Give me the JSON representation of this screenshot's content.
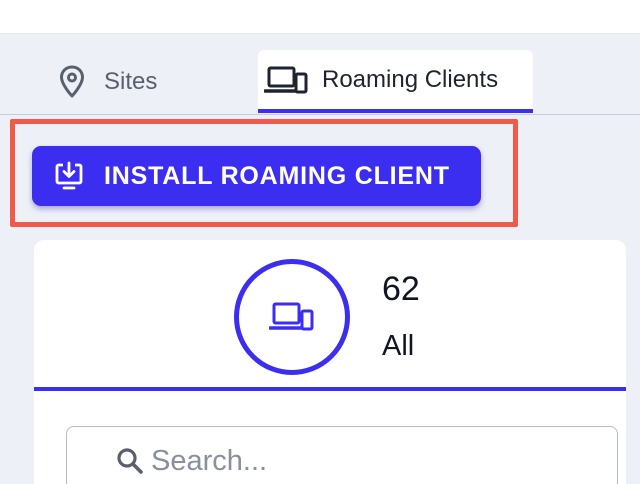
{
  "tabs": [
    {
      "label": "Sites",
      "icon": "location-pin-icon",
      "active": false
    },
    {
      "label": "Roaming Clients",
      "icon": "devices-icon",
      "active": true
    }
  ],
  "install_button": {
    "label": "INSTALL ROAMING CLIENT",
    "icon": "download-to-device-icon"
  },
  "stat": {
    "count": "62",
    "label": "All",
    "icon": "devices-icon"
  },
  "search": {
    "placeholder": "Search...",
    "value": ""
  },
  "colors": {
    "accent": "#3b2ef0",
    "highlight": "#f05a4b",
    "background": "#eef0f8"
  }
}
